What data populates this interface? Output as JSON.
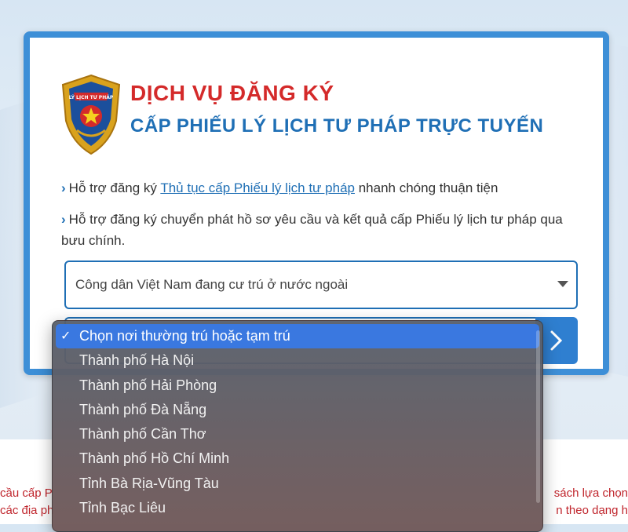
{
  "header": {
    "title_line1": "DỊCH VỤ ĐĂNG KÝ",
    "title_line2": "CẤP PHIẾU LÝ LỊCH TƯ PHÁP TRỰC TUYẾN"
  },
  "logo": {
    "text": "LÝ LỊCH TƯ PHÁP"
  },
  "info": {
    "bullet1_prefix": "Hỗ trợ đăng ký ",
    "bullet1_link": "Thủ tục cấp Phiếu lý lịch tư pháp",
    "bullet1_suffix": " nhanh chóng thuận tiện",
    "bullet2": "Hỗ trợ đăng ký chuyển phát hồ sơ yêu cầu và kết quả cấp Phiếu lý lịch tư pháp qua bưu chính."
  },
  "form": {
    "citizen_type_value": "Công dân Việt Nam đang cư trú ở nước ngoài"
  },
  "dropdown": {
    "options": [
      "Chọn nơi thường trú hoặc tạm trú",
      "Thành phố Hà Nội",
      "Thành phố Hải Phòng",
      "Thành phố Đà Nẵng",
      "Thành phố Cần Thơ",
      "Thành phố Hồ Chí Minh",
      "Tỉnh Bà Rịa-Vũng Tàu",
      "Tỉnh Bạc Liêu"
    ],
    "checkmark": "✓"
  },
  "notice": {
    "left_fragment_1": "cầu cấp P",
    "left_fragment_2": "các địa ph",
    "right_fragment_1": "sách lựa chọn",
    "right_fragment_2": "n theo dạng h"
  },
  "colors": {
    "brand_blue": "#1f6fb5",
    "title_red": "#d42a2a",
    "selected_option": "#3a78e0"
  }
}
